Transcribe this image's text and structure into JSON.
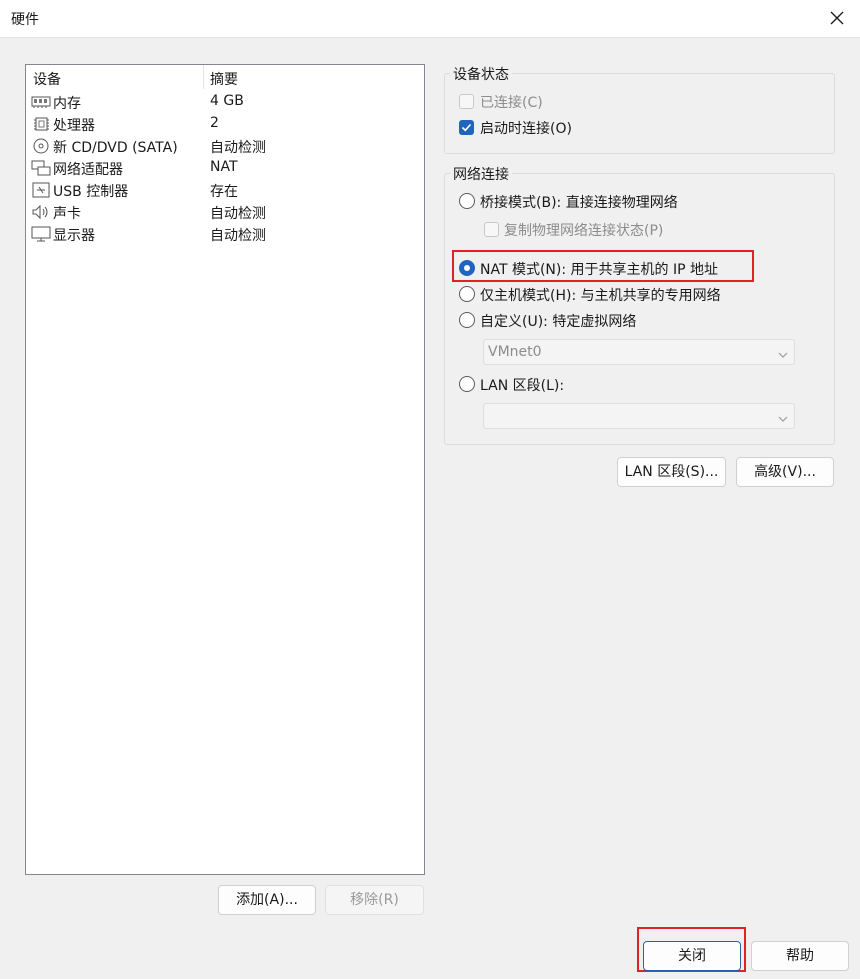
{
  "window": {
    "title": "硬件"
  },
  "device_list": {
    "headers": {
      "device": "设备",
      "summary": "摘要"
    },
    "items": [
      {
        "name": "内存",
        "summary": "4 GB",
        "icon": "memory-icon"
      },
      {
        "name": "处理器",
        "summary": "2",
        "icon": "processor-icon"
      },
      {
        "name": "新 CD/DVD (SATA)",
        "summary": "自动检测",
        "icon": "cd-dvd-icon"
      },
      {
        "name": "网络适配器",
        "summary": "NAT",
        "icon": "network-adapter-icon"
      },
      {
        "name": "USB 控制器",
        "summary": "存在",
        "icon": "usb-icon"
      },
      {
        "name": "声卡",
        "summary": "自动检测",
        "icon": "speaker-icon"
      },
      {
        "name": "显示器",
        "summary": "自动检测",
        "icon": "monitor-icon"
      }
    ],
    "add_label": "添加(A)...",
    "remove_label": "移除(R)"
  },
  "device_status": {
    "legend": "设备状态",
    "connected_label": "已连接(C)",
    "connect_at_poweron_label": "启动时连接(O)"
  },
  "network_connection": {
    "legend": "网络连接",
    "bridged_label": "桥接模式(B): 直接连接物理网络",
    "replicate_label": "复制物理网络连接状态(P)",
    "nat_label": "NAT 模式(N): 用于共享主机的 IP 地址",
    "hostonly_label": "仅主机模式(H): 与主机共享的专用网络",
    "custom_label": "自定义(U): 特定虚拟网络",
    "custom_select_value": "VMnet0",
    "lan_label": "LAN 区段(L):",
    "lan_select_value": ""
  },
  "actions": {
    "lan_segments_label": "LAN 区段(S)...",
    "advanced_label": "高级(V)...",
    "close_label": "关闭",
    "help_label": "帮助"
  },
  "colors": {
    "accent": "#1f65c0",
    "highlight": "#e0202a"
  }
}
